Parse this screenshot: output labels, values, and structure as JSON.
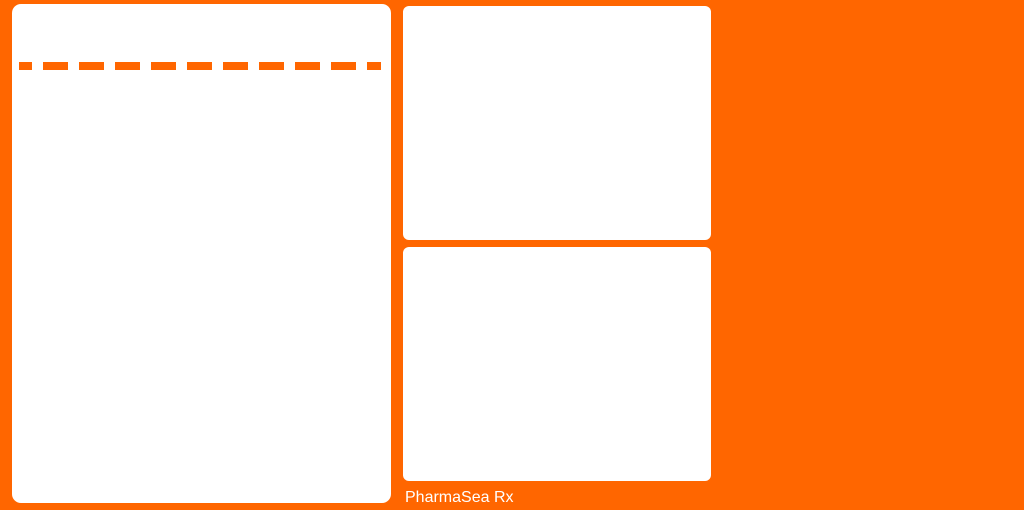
{
  "theme": {
    "background_color": "#FF6600",
    "panel_color": "#FFFFFF",
    "accent_color": "#FF6600",
    "label_color": "#FFFFFF"
  },
  "footer": {
    "brand_label": "PharmaSea Rx"
  }
}
